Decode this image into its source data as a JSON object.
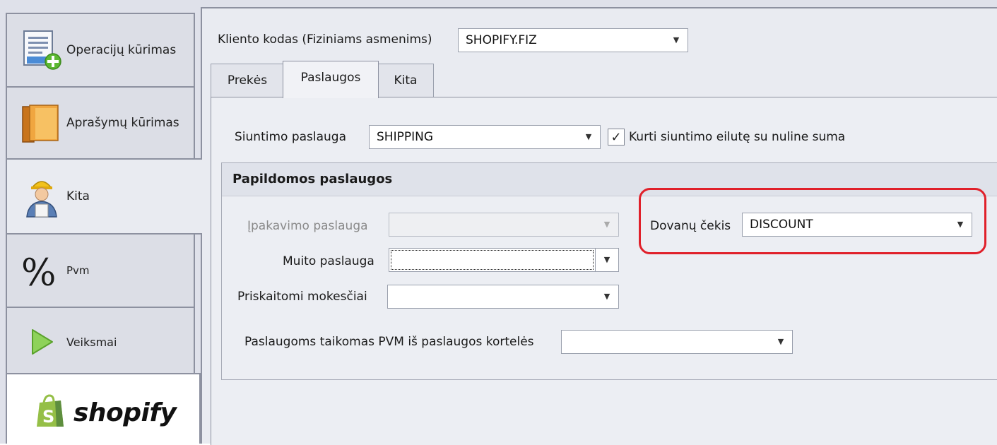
{
  "sidebar": {
    "items": [
      {
        "label": "Operacijų kūrimas",
        "icon": "document-add-icon"
      },
      {
        "label": "Aprašymų kūrimas",
        "icon": "books-icon"
      },
      {
        "label": "Kita",
        "icon": "worker-icon",
        "active": true
      },
      {
        "label": "Pvm",
        "icon": "percent-icon"
      },
      {
        "label": "Veiksmai",
        "icon": "play-icon"
      }
    ],
    "logo_text": "shopify",
    "logo_icon": "shopify-bag-icon"
  },
  "header": {
    "client_code_label": "Kliento kodas (Fiziniams asmenims)",
    "client_code_value": "SHOPIFY.FIZ"
  },
  "tabs": [
    {
      "label": "Prekės"
    },
    {
      "label": "Paslaugos",
      "active": true
    },
    {
      "label": "Kita"
    }
  ],
  "services": {
    "shipping_label": "Siuntimo paslauga",
    "shipping_value": "SHIPPING",
    "zero_shipping_checked": true,
    "zero_shipping_label": "Kurti siuntimo eilutę su nuline suma"
  },
  "additional": {
    "title": "Papildomos paslaugos",
    "packaging_label": "Įpakavimo paslauga",
    "packaging_value": "",
    "customs_label": "Muito paslauga",
    "customs_value": "",
    "fees_label": "Priskaitomi mokesčiai",
    "fees_value": "",
    "vat_label": "Paslaugoms taikomas PVM iš paslaugos kortelės",
    "vat_value": "",
    "gift_label": "Dovanų čekis",
    "gift_value": "DISCOUNT"
  },
  "colors": {
    "highlight": "#e0202a",
    "shopify_green": "#95bf47"
  }
}
